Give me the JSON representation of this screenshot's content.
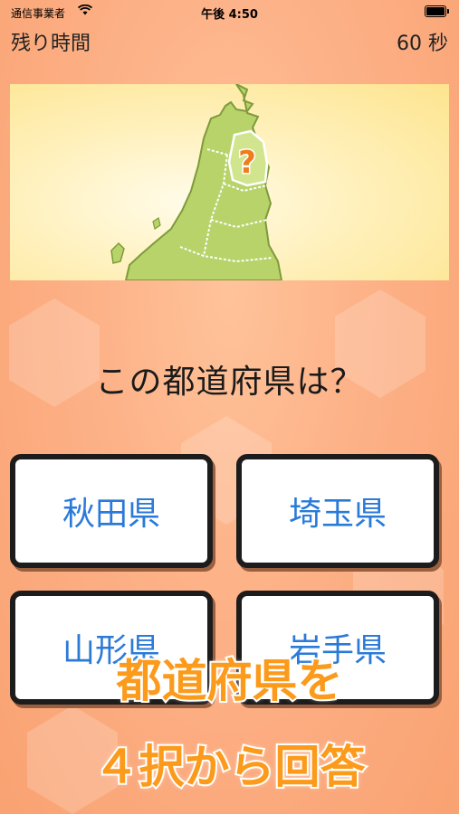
{
  "status": {
    "carrier": "通信事業者",
    "time": "午後 4:50"
  },
  "timer": {
    "label": "残り時間",
    "value": "60 秒"
  },
  "map": {
    "marker": "?",
    "highlight_color": "#ef7d1a"
  },
  "question": "この都道府県は？",
  "answers": [
    "秋田県",
    "埼玉県",
    "山形県",
    "岩手県"
  ],
  "caption": {
    "line1": "都道府県を",
    "line2": "４択から回答"
  },
  "colors": {
    "answer_text": "#2a7ad8",
    "caption": "#fb9a1b",
    "background": "#fdb288"
  }
}
